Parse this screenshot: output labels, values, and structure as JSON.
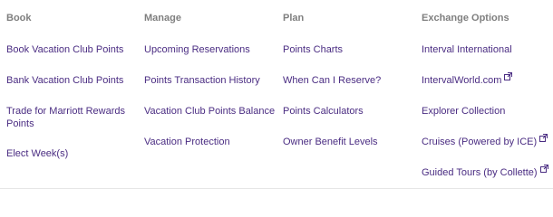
{
  "menu": {
    "columns": [
      {
        "heading": "Book",
        "links": [
          {
            "label": "Book Vacation Club Points"
          },
          {
            "label": "Bank Vacation Club Points"
          },
          {
            "label": "Trade for Marriott Rewards Points"
          },
          {
            "label": "Elect Week(s)"
          }
        ]
      },
      {
        "heading": "Manage",
        "links": [
          {
            "label": "Upcoming Reservations"
          },
          {
            "label": "Points Transaction History"
          },
          {
            "label": "Vacation Club Points Balance"
          },
          {
            "label": "Vacation Protection"
          }
        ]
      },
      {
        "heading": "Plan",
        "links": [
          {
            "label": "Points Charts"
          },
          {
            "label": "When Can I Reserve?"
          },
          {
            "label": "Points Calculators"
          },
          {
            "label": "Owner Benefit Levels"
          }
        ]
      },
      {
        "heading": "Exchange Options",
        "links": [
          {
            "label": "Interval International",
            "external": false
          },
          {
            "label": "IntervalWorld.com",
            "external": true,
            "icon": "external-link-icon"
          },
          {
            "label": "Explorer Collection",
            "external": false
          },
          {
            "label": "Cruises (Powered by ICE)",
            "external": true,
            "icon": "external-link-icon"
          },
          {
            "label": "Guided Tours (by Collette)",
            "external": true,
            "icon": "external-link-icon"
          }
        ]
      }
    ]
  },
  "colors": {
    "heading": "#7f7f7f",
    "link": "#4a2c82",
    "background": "#ffffff"
  }
}
